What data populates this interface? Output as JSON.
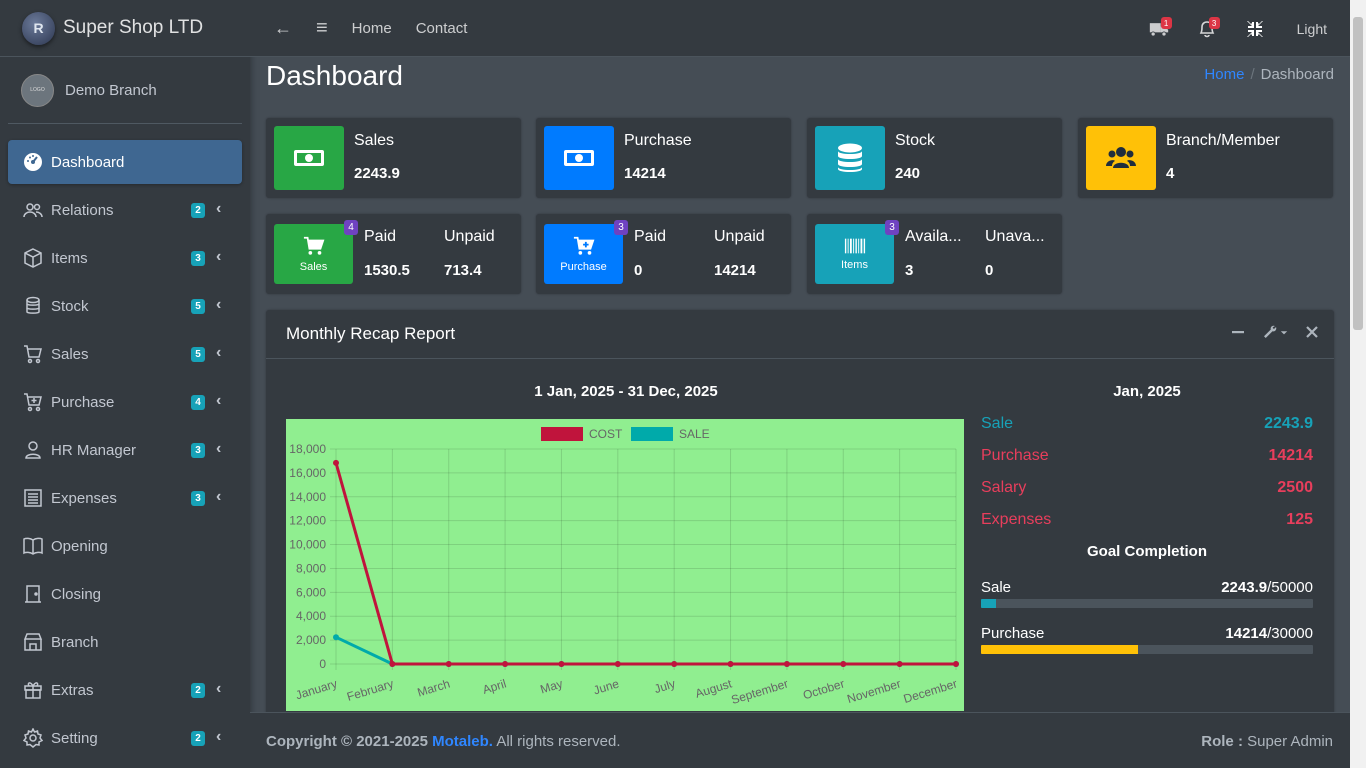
{
  "brand": {
    "name": "Super Shop LTD",
    "logo_letter": "R"
  },
  "user": {
    "name": "Demo Branch",
    "avatar_text": "LOGO"
  },
  "sidebar": {
    "items": [
      {
        "label": "Dashboard",
        "icon": "dashboard-gauge-icon",
        "badge": "",
        "active": true
      },
      {
        "label": "Relations",
        "icon": "users-icon",
        "badge": "2"
      },
      {
        "label": "Items",
        "icon": "box-icon",
        "badge": "3"
      },
      {
        "label": "Stock",
        "icon": "database-icon",
        "badge": "5"
      },
      {
        "label": "Sales",
        "icon": "cart-icon",
        "badge": "5"
      },
      {
        "label": "Purchase",
        "icon": "cart-plus-icon",
        "badge": "4"
      },
      {
        "label": "HR Manager",
        "icon": "user-icon",
        "badge": "3"
      },
      {
        "label": "Expenses",
        "icon": "receipt-icon",
        "badge": "3"
      },
      {
        "label": "Opening",
        "icon": "book-open-icon",
        "badge": ""
      },
      {
        "label": "Closing",
        "icon": "door-icon",
        "badge": ""
      },
      {
        "label": "Branch",
        "icon": "store-icon",
        "badge": ""
      },
      {
        "label": "Extras",
        "icon": "gift-icon",
        "badge": "2"
      },
      {
        "label": "Setting",
        "icon": "gear-icon",
        "badge": "2"
      }
    ]
  },
  "topbar": {
    "back": "←",
    "menu": "≡",
    "home": "Home",
    "contact": "Contact",
    "truck_count": "1",
    "bell_count": "3",
    "theme_label": "Light"
  },
  "header": {
    "title": "Dashboard",
    "breadcrumb_home": "Home",
    "breadcrumb_sep": "/",
    "breadcrumb_current": "Dashboard"
  },
  "stats": {
    "sales": {
      "label": "Sales",
      "value": "2243.9"
    },
    "purchase": {
      "label": "Purchase",
      "value": "14214"
    },
    "stock": {
      "label": "Stock",
      "value": "240"
    },
    "branch": {
      "label": "Branch/Member",
      "value": "4"
    }
  },
  "split_boxes": {
    "sales": {
      "icon_label": "Sales",
      "badge": "4",
      "col1_label": "Paid",
      "col1_value": "1530.5",
      "col2_label": "Unpaid",
      "col2_value": "713.4"
    },
    "purchase": {
      "icon_label": "Purchase",
      "badge": "3",
      "col1_label": "Paid",
      "col1_value": "0",
      "col2_label": "Unpaid",
      "col2_value": "14214"
    },
    "items": {
      "icon_label": "Items",
      "badge": "3",
      "col1_label": "Availa...",
      "col1_value": "3",
      "col2_label": "Unava...",
      "col2_value": "0"
    }
  },
  "report": {
    "title": "Monthly Recap Report",
    "range": "1 Jan, 2025 - 31 Dec, 2025",
    "month": "Jan, 2025",
    "rows": [
      {
        "label": "Sale",
        "value": "2243.9",
        "color": "#17a2b8"
      },
      {
        "label": "Purchase",
        "value": "14214",
        "color": "#e83e5c"
      },
      {
        "label": "Salary",
        "value": "2500",
        "color": "#e83e5c"
      },
      {
        "label": "Expenses",
        "value": "125",
        "color": "#e83e5c"
      }
    ],
    "goal_title": "Goal Completion",
    "goals": [
      {
        "label": "Sale",
        "current": "2243.9",
        "target": "/50000",
        "fraction": 0.0449,
        "color": "#17a2b8"
      },
      {
        "label": "Purchase",
        "current": "14214",
        "target": "/30000",
        "fraction": 0.4738,
        "color": "#ffc107"
      }
    ]
  },
  "chart_data": {
    "type": "line",
    "background": "#90ee90",
    "categories": [
      "January",
      "February",
      "March",
      "April",
      "May",
      "June",
      "July",
      "August",
      "September",
      "October",
      "November",
      "December"
    ],
    "series": [
      {
        "name": "COST",
        "color": "#c0143c",
        "values": [
          16839,
          0,
          0,
          0,
          0,
          0,
          0,
          0,
          0,
          0,
          0,
          0
        ]
      },
      {
        "name": "SALE",
        "color": "#00aaaa",
        "values": [
          2243.9,
          0,
          0,
          0,
          0,
          0,
          0,
          0,
          0,
          0,
          0,
          0
        ]
      }
    ],
    "yticks": [
      "0",
      "2,000",
      "4,000",
      "6,000",
      "8,000",
      "10,000",
      "12,000",
      "14,000",
      "16,000",
      "18,000"
    ],
    "ylim": [
      0,
      18000
    ],
    "legend": "top-center",
    "grid": true
  },
  "footer": {
    "copyright": "Copyright © 2021-2025",
    "author": "Motaleb.",
    "rights": "All rights reserved.",
    "role_label": "Role :",
    "role_value": "Super Admin"
  }
}
